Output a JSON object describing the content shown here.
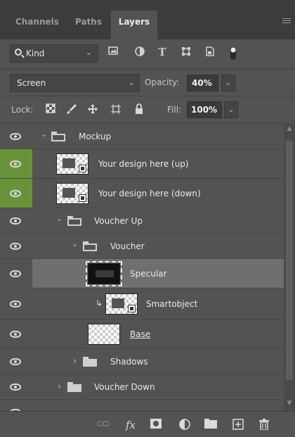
{
  "tabs": [
    {
      "label": "Channels",
      "active": false
    },
    {
      "label": "Paths",
      "active": false
    },
    {
      "label": "Layers",
      "active": true
    }
  ],
  "filter": {
    "kind_label": "Kind",
    "icons": [
      "image-filter-icon",
      "adjustment-filter-icon",
      "type-filter-icon",
      "shape-filter-icon",
      "smartobject-filter-icon",
      "filter-toggle-icon"
    ]
  },
  "blend": {
    "mode": "Screen",
    "opacity_label": "Opacity:",
    "opacity_value": "40%"
  },
  "lock": {
    "label": "Lock:",
    "icons": [
      "lock-transparent-pixels-icon",
      "lock-image-pixels-icon",
      "lock-position-icon",
      "lock-artboard-icon",
      "lock-all-icon"
    ],
    "fill_label": "Fill:",
    "fill_value": "100%"
  },
  "layers": [
    {
      "name": "Mockup",
      "type": "group-open",
      "indent": 0
    },
    {
      "name": "Your design here (up)",
      "type": "smartobject",
      "indent": 1
    },
    {
      "name": "Your design here (down)",
      "type": "smartobject",
      "indent": 1
    },
    {
      "name": "Voucher Up",
      "type": "group-open",
      "indent": 1
    },
    {
      "name": "Voucher",
      "type": "group-open",
      "indent": 2
    },
    {
      "name": "Specular",
      "type": "layer",
      "indent": 3,
      "selected": true
    },
    {
      "name": "Smartobject",
      "type": "smartobject-clipped",
      "indent": 3
    },
    {
      "name": "Base",
      "type": "layer",
      "indent": 3
    },
    {
      "name": "Shadows",
      "type": "group-closed",
      "indent": 2
    },
    {
      "name": "Voucher Down",
      "type": "group-closed",
      "indent": 1
    }
  ],
  "footer_icons": [
    "link-layers-icon",
    "fx-icon",
    "add-mask-icon",
    "adjustment-layer-icon",
    "new-group-icon",
    "new-layer-icon",
    "delete-icon"
  ],
  "colors": {
    "panel": "#535353",
    "tabbar": "#3c3c3c",
    "selected": "#6f6f6f",
    "visibility_highlight": "#68933a"
  }
}
